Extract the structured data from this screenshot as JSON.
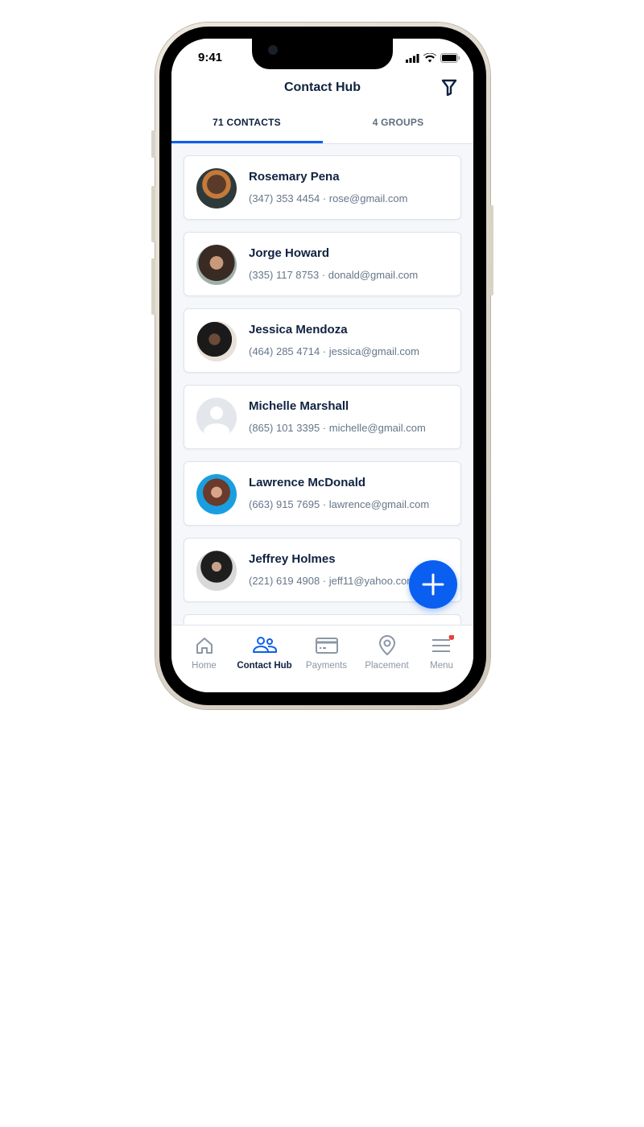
{
  "status_bar": {
    "time": "9:41"
  },
  "header": {
    "title": "Contact Hub"
  },
  "tabs": [
    {
      "label": "71 CONTACTS",
      "active": true
    },
    {
      "label": "4 GROUPS",
      "active": false
    }
  ],
  "contacts": [
    {
      "name": "Rosemary Pena",
      "detail": "(347) 353 4454 · rose@gmail.com",
      "avatar": "photo"
    },
    {
      "name": "Jorge Howard",
      "detail": "(335) 117 8753 · donald@gmail.com",
      "avatar": "photo"
    },
    {
      "name": "Jessica Mendoza",
      "detail": "(464) 285 4714 · jessica@gmail.com",
      "avatar": "photo"
    },
    {
      "name": "Michelle Marshall",
      "detail": "(865) 101 3395 · michelle@gmail.com",
      "avatar": "placeholder"
    },
    {
      "name": "Lawrence McDonald",
      "detail": "(663) 915 7695 · lawrence@gmail.com",
      "avatar": "photo"
    },
    {
      "name": "Jeffrey Holmes",
      "detail": "(221) 619 4908 · jeff11@yahoo.com",
      "avatar": "photo"
    }
  ],
  "nav": [
    {
      "label": "Home",
      "icon": "home-icon"
    },
    {
      "label": "Contact Hub",
      "icon": "contacts-icon",
      "active": true
    },
    {
      "label": "Payments",
      "icon": "card-icon"
    },
    {
      "label": "Placement",
      "icon": "location-icon"
    },
    {
      "label": "Menu",
      "icon": "menu-icon",
      "badge": true
    }
  ],
  "colors": {
    "accent": "#0a5ff0",
    "text": "#0f2240",
    "badge": "#e8413a"
  }
}
